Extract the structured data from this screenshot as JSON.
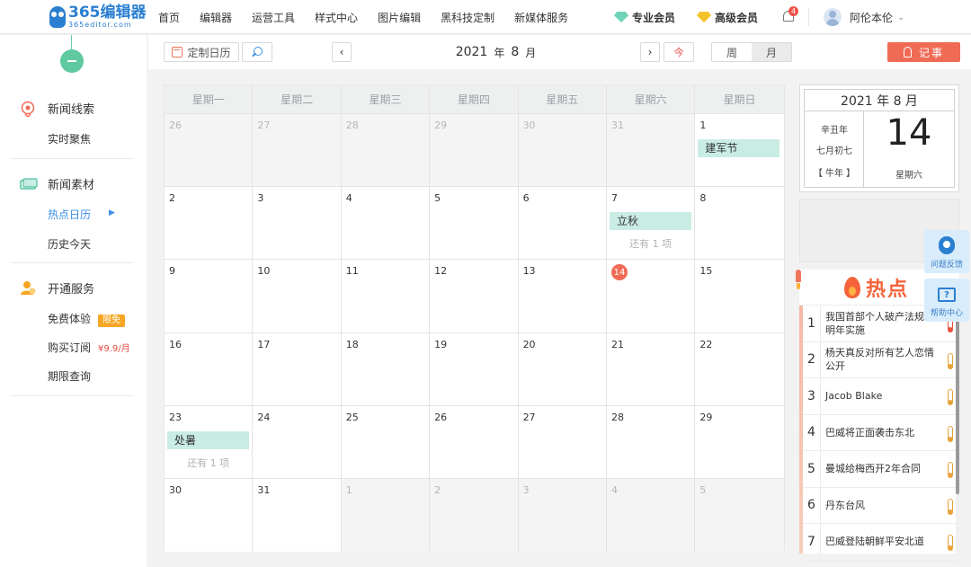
{
  "logo": {
    "main": "365编辑器",
    "sub": "365editor.com"
  },
  "nav": [
    "首页",
    "编辑器",
    "运营工具",
    "样式中心",
    "图片编辑",
    "黑科技定制",
    "新媒体服务"
  ],
  "members": {
    "pro": "专业会员",
    "advanced": "高级会员"
  },
  "notifications": {
    "count": "4"
  },
  "user": {
    "name": "阿伦本伦"
  },
  "sidebar": {
    "groups": [
      {
        "title": "新闻线索",
        "icon": "target-icon",
        "items": [
          "实时聚焦"
        ]
      },
      {
        "title": "新闻素材",
        "icon": "materials-icon",
        "items": [
          "热点日历",
          "历史今天"
        ],
        "active": "热点日历"
      },
      {
        "title": "开通服务",
        "icon": "service-icon",
        "items": [
          "免费体验",
          "购买订阅",
          "期限查询"
        ]
      }
    ],
    "free_tag": "限免",
    "price": "¥9.9/月"
  },
  "toolbar": {
    "custom_calendar": "定制日历",
    "year": "2021",
    "year_unit": "年",
    "month": "8",
    "month_unit": "月",
    "today": "今",
    "view_week": "周",
    "view_month": "月",
    "note": "记事"
  },
  "calendar": {
    "weekdays": [
      "星期一",
      "星期二",
      "星期三",
      "星期四",
      "星期五",
      "星期六",
      "星期日"
    ],
    "today": 14,
    "more_label": "还有 1 项",
    "weeks": [
      [
        {
          "d": "26",
          "o": true
        },
        {
          "d": "27",
          "o": true
        },
        {
          "d": "28",
          "o": true
        },
        {
          "d": "29",
          "o": true
        },
        {
          "d": "30",
          "o": true
        },
        {
          "d": "31",
          "o": true
        },
        {
          "d": "1",
          "e": "建军节"
        }
      ],
      [
        {
          "d": "2"
        },
        {
          "d": "3"
        },
        {
          "d": "4"
        },
        {
          "d": "5"
        },
        {
          "d": "6"
        },
        {
          "d": "7",
          "e": "立秋",
          "m": true
        },
        {
          "d": "8"
        }
      ],
      [
        {
          "d": "9"
        },
        {
          "d": "10"
        },
        {
          "d": "11"
        },
        {
          "d": "12"
        },
        {
          "d": "13"
        },
        {
          "d": "14"
        },
        {
          "d": "15"
        }
      ],
      [
        {
          "d": "16"
        },
        {
          "d": "17"
        },
        {
          "d": "18"
        },
        {
          "d": "19"
        },
        {
          "d": "20"
        },
        {
          "d": "21"
        },
        {
          "d": "22"
        }
      ],
      [
        {
          "d": "23",
          "e": "处暑",
          "m": true
        },
        {
          "d": "24"
        },
        {
          "d": "25"
        },
        {
          "d": "26"
        },
        {
          "d": "27"
        },
        {
          "d": "28"
        },
        {
          "d": "29"
        }
      ],
      [
        {
          "d": "30"
        },
        {
          "d": "31"
        },
        {
          "d": "1",
          "o": true
        },
        {
          "d": "2",
          "o": true
        },
        {
          "d": "3",
          "o": true
        },
        {
          "d": "4",
          "o": true
        },
        {
          "d": "5",
          "o": true
        }
      ]
    ]
  },
  "date_card": {
    "title": "2021 年 8 月",
    "ganzhi": "辛丑年",
    "lunar": "七月初七",
    "zodiac": "【 牛年 】",
    "day": "14",
    "weekday": "星期六"
  },
  "hot": {
    "title": "热点",
    "items": [
      {
        "rank": "1",
        "text": "我国首部个人破产法规于明年实施",
        "level": "hot"
      },
      {
        "rank": "2",
        "text": "杨天真反对所有艺人恋情公开",
        "level": "warm"
      },
      {
        "rank": "3",
        "text": "Jacob Blake",
        "level": "warm"
      },
      {
        "rank": "4",
        "text": "巴威将正面袭击东北",
        "level": "warm"
      },
      {
        "rank": "5",
        "text": "曼城给梅西开2年合同",
        "level": "warm"
      },
      {
        "rank": "6",
        "text": "丹东台风",
        "level": "warm"
      },
      {
        "rank": "7",
        "text": "巴威登陆朝鲜平安北道",
        "level": "warm"
      }
    ]
  },
  "float": {
    "feedback": "问题反馈",
    "help": "帮助中心"
  },
  "colors": {
    "accent": "#3a8ee6",
    "today": "#f06b56",
    "event": "#c9ece4",
    "hot": "#f5633b"
  }
}
